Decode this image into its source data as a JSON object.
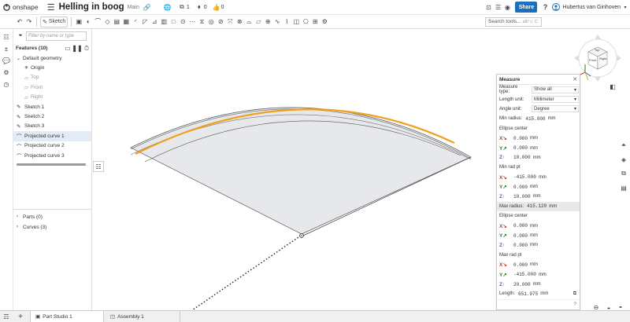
{
  "app": {
    "logo_text": "onshape",
    "doc_title": "Helling in boog",
    "branch": "Main"
  },
  "header": {
    "versions_count": "1",
    "tags_count": "0",
    "likes_count": "0",
    "share_label": "Share",
    "user_name": "Hubertus van Ginhoven",
    "help_label": "?"
  },
  "toolbar": {
    "sketch_label": "Sketch",
    "search_label": "Search tools...",
    "search_shortcut": "alt/⌥ C"
  },
  "features": {
    "filter_placeholder": "Filter by name or type",
    "header_label": "Features (10)",
    "items": [
      {
        "label": "Default geometry"
      },
      {
        "label": "Origin"
      },
      {
        "label": "Top"
      },
      {
        "label": "Front"
      },
      {
        "label": "Right"
      },
      {
        "label": "Sketch 1"
      },
      {
        "label": "Sketch 2"
      },
      {
        "label": "Sketch 3"
      },
      {
        "label": "Projected curve 1"
      },
      {
        "label": "Projected curve 2"
      },
      {
        "label": "Projected curve 3"
      }
    ],
    "parts_label": "Parts (0)",
    "curves_label": "Curves (3)"
  },
  "viewcube": {
    "top": "Top",
    "front": "Front",
    "right": "Right"
  },
  "measure": {
    "title": "Measure",
    "type_label": "Measure type:",
    "type_value": "Show all",
    "length_label": "Length unit:",
    "length_value": "Millimeter",
    "angle_label": "Angle unit:",
    "angle_value": "Degree",
    "min_radius_label": "Min radius:",
    "min_radius_value": "415.000",
    "min_radius_unit": "mm",
    "ellipse_center_label": "Ellipse center",
    "ec1": {
      "x": "0.000",
      "y": "0.000",
      "z": "10.000"
    },
    "min_rad_pt_label": "Min rad pt",
    "mrp": {
      "x": "-415.000",
      "y": "0.000",
      "z": "10.000"
    },
    "max_radius_label": "Max radius:",
    "max_radius_value": "415.120",
    "max_radius_unit": "mm",
    "ec2": {
      "x": "0.000",
      "y": "0.000",
      "z": "0.000"
    },
    "max_rad_pt_label": "Max rad pt",
    "xrp": {
      "x": "0.000",
      "y": "-415.000",
      "z": "20.000"
    },
    "length_result_label": "Length:",
    "length_result_value": "651.975",
    "unit": "mm",
    "x_letter": "X",
    "y_letter": "Y",
    "z_letter": "Z"
  },
  "tabs": {
    "part_studio": "Part Studio 1",
    "assembly": "Assembly 1"
  }
}
